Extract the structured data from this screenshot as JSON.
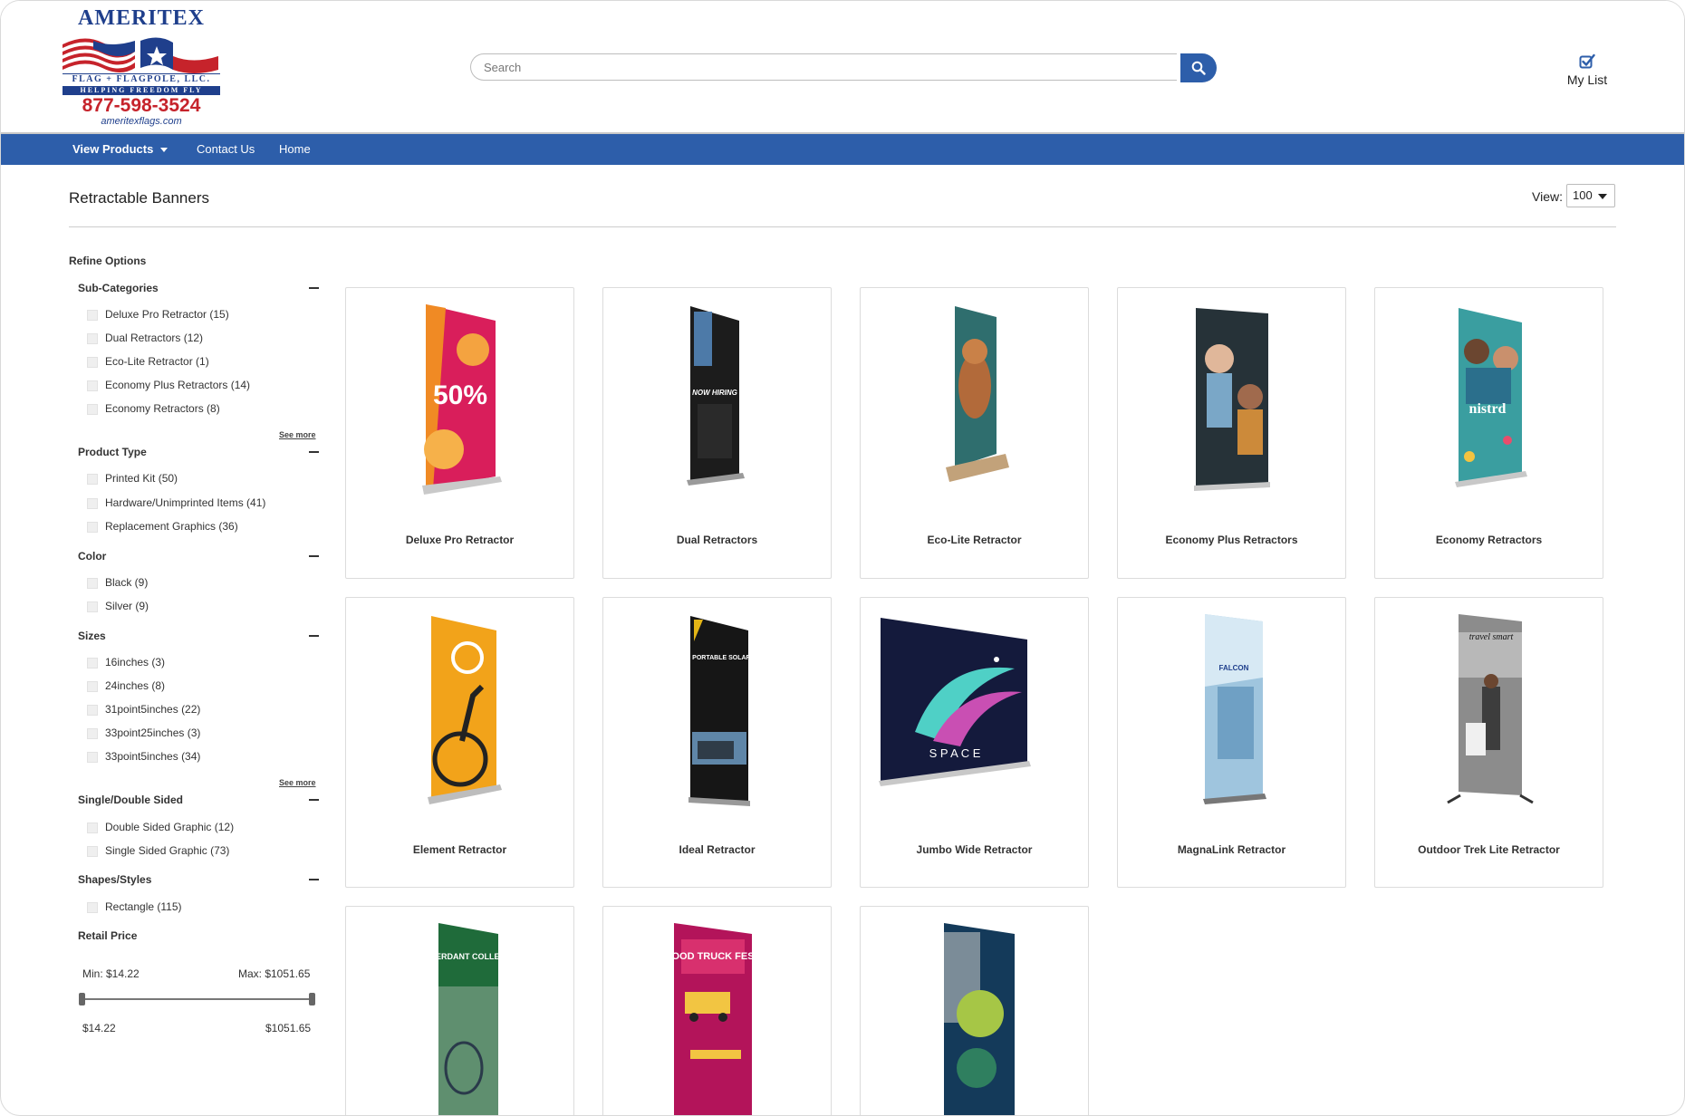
{
  "logo": {
    "title": "AMERITEX",
    "line1": "FLAG + FLAGPOLE, LLC.",
    "line2": "HELPING FREEDOM FLY",
    "phone": "877-598-3524",
    "url": "ameritexflags.com"
  },
  "search": {
    "placeholder": "Search"
  },
  "mylist": {
    "label": "My List"
  },
  "nav": {
    "view_products": "View Products",
    "contact": "Contact Us",
    "home": "Home"
  },
  "page": {
    "title": "Retractable Banners",
    "view_label": "View:",
    "view_value": "100"
  },
  "sidebar": {
    "refine_title": "Refine Options",
    "see_more": "See more",
    "facets": {
      "subcategories": {
        "title": "Sub-Categories",
        "options": [
          "Deluxe Pro Retractor (15)",
          "Dual Retractors (12)",
          "Eco-Lite Retractor (1)",
          "Economy Plus Retractors (14)",
          "Economy Retractors (8)"
        ]
      },
      "product_type": {
        "title": "Product Type",
        "options": [
          "Printed Kit (50)",
          "Hardware/Unimprinted Items (41)",
          "Replacement Graphics (36)"
        ]
      },
      "color": {
        "title": "Color",
        "options": [
          "Black (9)",
          "Silver (9)"
        ]
      },
      "sizes": {
        "title": "Sizes",
        "options": [
          "16inches (3)",
          "24inches (8)",
          "31point5inches (22)",
          "33point25inches (3)",
          "33point5inches (34)"
        ]
      },
      "sided": {
        "title": "Single/Double Sided",
        "options": [
          "Double Sided Graphic (12)",
          "Single Sided Graphic (73)"
        ]
      },
      "shapes": {
        "title": "Shapes/Styles",
        "options": [
          "Rectangle (115)"
        ]
      }
    },
    "price": {
      "title": "Retail Price",
      "min_label": "Min: $14.22",
      "max_label": "Max: $1051.65",
      "min_value": "$14.22",
      "max_value": "$1051.65"
    }
  },
  "products": [
    {
      "name": "Deluxe Pro Retractor",
      "banner_text": "50%"
    },
    {
      "name": "Dual Retractors",
      "banner_text": "NOW HIRING"
    },
    {
      "name": "Eco-Lite Retractor",
      "banner_text": ""
    },
    {
      "name": "Economy Plus Retractors",
      "banner_text": ""
    },
    {
      "name": "Economy Retractors",
      "banner_text": "nistrd"
    },
    {
      "name": "Element Retractor",
      "banner_text": ""
    },
    {
      "name": "Ideal Retractor",
      "banner_text": "BEST RATED PORTABLE SOLAR CHARGER"
    },
    {
      "name": "Jumbo Wide Retractor",
      "banner_text": "S P A C E"
    },
    {
      "name": "MagnaLink Retractor",
      "banner_text": "FALCON"
    },
    {
      "name": "Outdoor Trek Lite Retractor",
      "banner_text": "travel smart"
    },
    {
      "name": "",
      "banner_text": "THE VERDANT COLLECTION"
    },
    {
      "name": "",
      "banner_text": "FOOD TRUCK FEST"
    },
    {
      "name": "",
      "banner_text": ""
    }
  ],
  "colors": {
    "brand_blue": "#2d5eaa",
    "logo_red": "#c6232b"
  }
}
